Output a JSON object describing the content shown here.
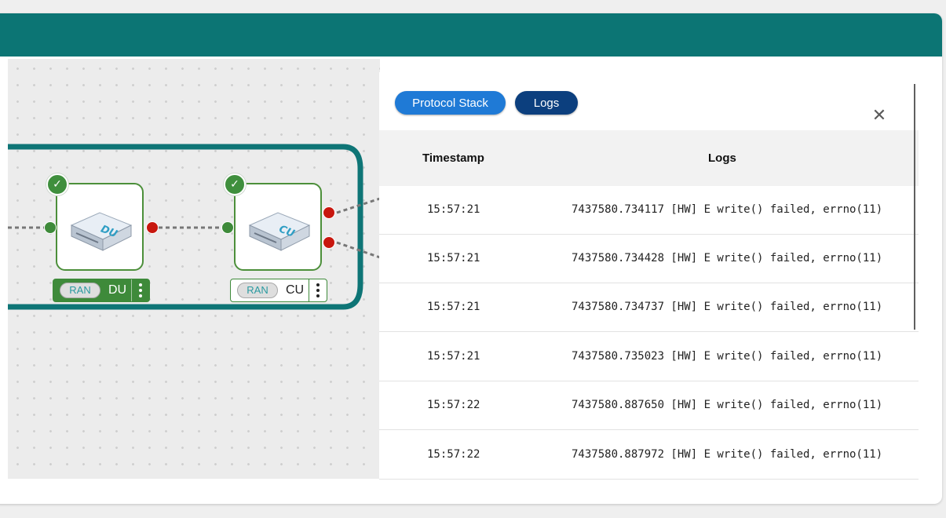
{
  "canvas": {
    "nodes": [
      {
        "name": "DU",
        "tag": "RAN",
        "image_label": "DU",
        "status": "ok"
      },
      {
        "name": "CU",
        "tag": "RAN",
        "image_label": "CU",
        "status": "ok"
      }
    ]
  },
  "panel": {
    "tabs": [
      {
        "label": "Protocol Stack",
        "active": false
      },
      {
        "label": "Logs",
        "active": true
      }
    ],
    "columns": {
      "timestamp": "Timestamp",
      "logs": "Logs"
    },
    "rows": [
      {
        "timestamp": "15:57:21",
        "message": "7437580.734117 [HW] E write() failed, errno(11)"
      },
      {
        "timestamp": "15:57:21",
        "message": "7437580.734428 [HW] E write() failed, errno(11)"
      },
      {
        "timestamp": "15:57:21",
        "message": "7437580.734737 [HW] E write() failed, errno(11)"
      },
      {
        "timestamp": "15:57:21",
        "message": "7437580.735023 [HW] E write() failed, errno(11)"
      },
      {
        "timestamp": "15:57:22",
        "message": "7437580.887650 [HW] E write() failed, errno(11)"
      },
      {
        "timestamp": "15:57:22",
        "message": "7437580.887972 [HW] E write() failed, errno(11)"
      }
    ]
  },
  "colors": {
    "topbar": "#0c7574",
    "node_border": "#3e8a3a",
    "port_green": "#3e8a3a",
    "port_red": "#c8170e",
    "tab_protocol": "#1f7ad6",
    "tab_logs": "#0c3f7e"
  }
}
